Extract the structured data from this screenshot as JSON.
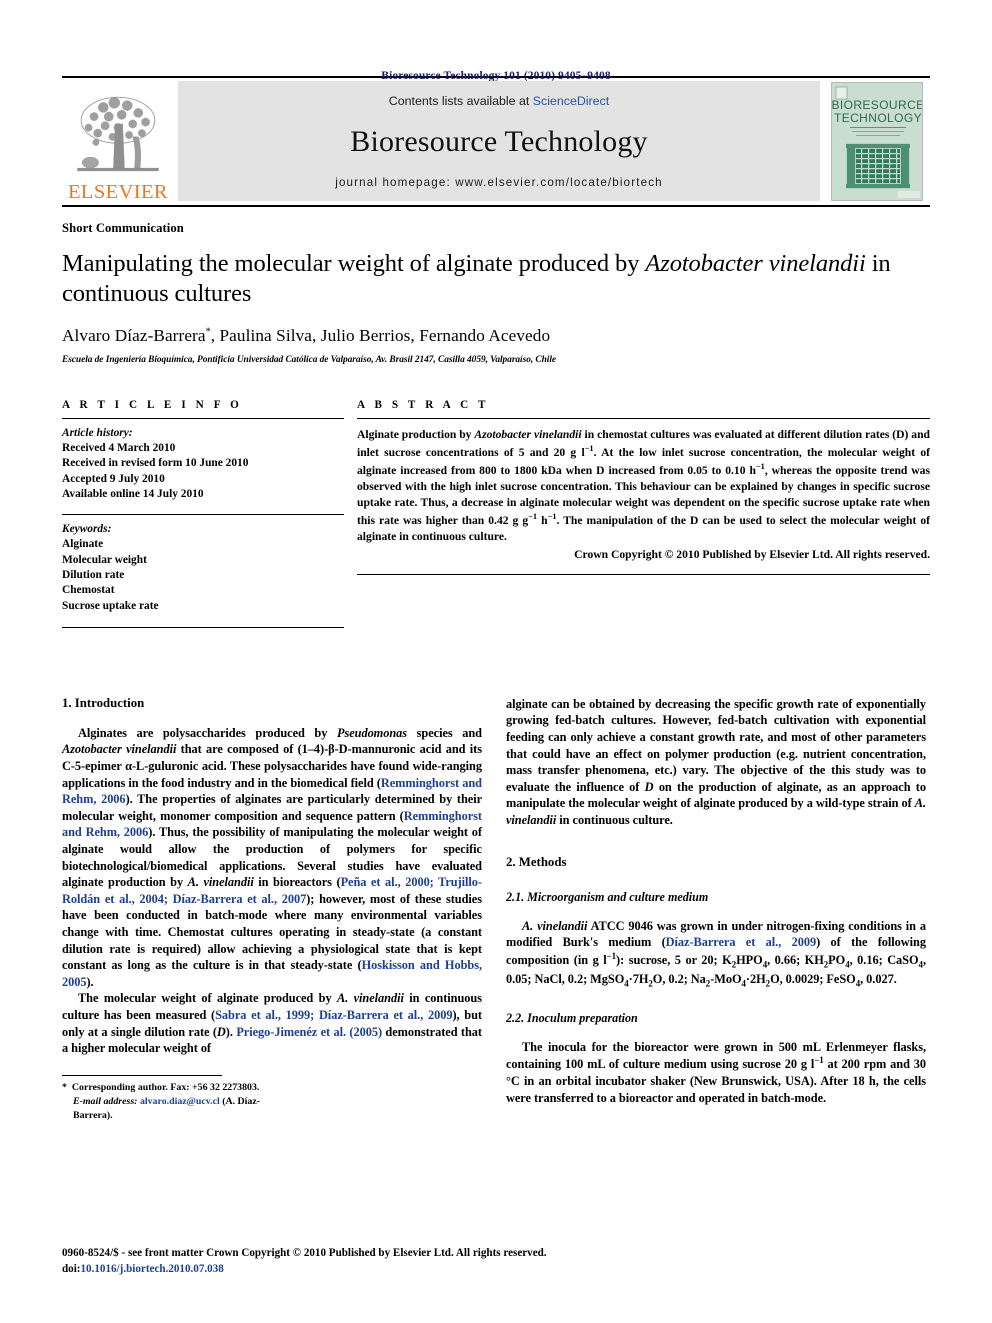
{
  "running_head": "Bioresource Technology 101 (2010) 9405–9408",
  "masthead": {
    "contents_prefix": "Contents lists available at ",
    "sciencedirect": "ScienceDirect",
    "journal_title": "Bioresource Technology",
    "homepage": "journal homepage: www.elsevier.com/locate/biortech",
    "publisher_wordmark": "ELSEVIER",
    "publisher_color": "#E87722",
    "link_color": "#2a4fb5",
    "cover_title_line1": "BIORESOURCE",
    "cover_title_line2": "TECHNOLOGY",
    "cover_accent": "#3f7f63"
  },
  "article": {
    "section_type": "Short Communication",
    "title_part1": "Manipulating the molecular weight of alginate produced by ",
    "title_italic": "Azotobacter vinelandii",
    "title_part2": " in continuous cultures",
    "authors": "Alvaro Díaz-Barrera",
    "authors_rest": ", Paulina Silva, Julio Berrios, Fernando Acevedo",
    "corresponding_marker": "*",
    "affiliation": "Escuela de Ingeniería Bioquímica, Pontificia Universidad Católica de Valparaíso, Av. Brasil 2147, Casilla 4059, Valparaíso, Chile"
  },
  "article_info": {
    "heading": "A R T I C L E   I N F O",
    "history_label": "Article history:",
    "history": [
      "Received 4 March 2010",
      "Received in revised form 10 June 2010",
      "Accepted 9 July 2010",
      "Available online 14 July 2010"
    ],
    "keywords_label": "Keywords:",
    "keywords": [
      "Alginate",
      "Molecular weight",
      "Dilution rate",
      "Chemostat",
      "Sucrose uptake rate"
    ]
  },
  "abstract": {
    "heading": "A B S T R A C T",
    "text_1": "Alginate production by ",
    "text_italic_1": "Azotobacter vinelandii",
    "text_2": " in chemostat cultures was evaluated at different dilution rates (D) and inlet sucrose concentrations of 5 and 20 g l",
    "sup_1": "−1",
    "text_3": ". At the low inlet sucrose concentration, the molecular weight of alginate increased from 800 to 1800 kDa when D increased from 0.05 to 0.10 h",
    "sup_2": "−1",
    "text_4": ", whereas the opposite trend was observed with the high inlet sucrose concentration. This behaviour can be explained by changes in specific sucrose uptake rate. Thus, a decrease in alginate molecular weight was dependent on the specific sucrose uptake rate when this rate was higher than 0.42 g g",
    "sup_3": "−1",
    "text_5": " h",
    "sup_4": "−1",
    "text_6": ". The manipulation of the D can be used to select the molecular weight of alginate in continuous culture.",
    "copyright": "Crown Copyright © 2010 Published by Elsevier Ltd. All rights reserved."
  },
  "sections": {
    "introduction_heading": "1. Introduction",
    "intro_p1_a": "Alginates are polysaccharides produced by ",
    "intro_p1_it1": "Pseudomonas",
    "intro_p1_b": " species and ",
    "intro_p1_it2": "Azotobacter vinelandii",
    "intro_p1_c": " that are composed of (1–4)-β-",
    "intro_p1_sc1": "D",
    "intro_p1_d": "-mannuronic acid and its C-5-epimer α-",
    "intro_p1_sc2": "L",
    "intro_p1_e": "-guluronic acid. These polysaccharides have found wide-ranging applications in the food industry and in the biomedical field (",
    "intro_p1_cite1": "Remminghorst and Rehm, 2006",
    "intro_p1_f": "). The properties of alginates are particularly determined by their molecular weight, monomer composition and sequence pattern (",
    "intro_p1_cite2": "Remminghorst and Rehm, 2006",
    "intro_p1_g": "). Thus, the possibility of manipulating the molecular weight of alginate would allow the production of polymers for specific biotechnological/biomedical applications. Several studies have evaluated alginate production by ",
    "intro_p1_it3": "A. vinelandii",
    "intro_p1_h": " in bioreactors (",
    "intro_p1_cite3": "Peña et al., 2000; Trujillo-Roldán et al., 2004; Díaz-Barrera et al., 2007",
    "intro_p1_i": "); however, most of these studies have been conducted in batch-mode where many environmental variables change with time. Chemostat cultures operating in steady-state (a constant dilution rate is required) allow achieving a physiological state that is kept constant as long as the culture is in that steady-state (",
    "intro_p1_cite4": "Hoskisson and Hobbs, 2005",
    "intro_p1_j": ").",
    "intro_p2_a": "The molecular weight of alginate produced by ",
    "intro_p2_it1": "A. vinelandii",
    "intro_p2_b": " in continuous culture has been measured (",
    "intro_p2_cite1": "Sabra et al., 1999; Díaz-Barrera et al., 2009",
    "intro_p2_c": "), but only at a single dilution rate (",
    "intro_p2_it2": "D",
    "intro_p2_d": "). ",
    "intro_p2_cite2": "Priego-Jimenéz et al. (2005)",
    "intro_p2_e": " demonstrated that a higher molecular weight of",
    "intro_cont_a": "alginate can be obtained by decreasing the specific growth rate of exponentially growing fed-batch cultures. However, fed-batch cultivation with exponential feeding can only achieve a constant growth rate, and most of other parameters that could have an effect on polymer production (e.g. nutrient concentration, mass transfer phenomena, etc.) vary. The objective of the this study was to evaluate the influence of ",
    "intro_cont_it1": "D",
    "intro_cont_b": " on the production of alginate, as an approach to manipulate the molecular weight of alginate produced by a wild-type strain of ",
    "intro_cont_it2": "A. vinelandii",
    "intro_cont_c": " in continuous culture.",
    "methods_heading": "2. Methods",
    "sub_21_heading": "2.1. Microorganism and culture medium",
    "sub_21_a": "A. vinelandii",
    "sub_21_b": " ATCC 9046 was grown in under nitrogen-fixing conditions in a modified Burk's medium (",
    "sub_21_cite": "Díaz-Barrera et al., 2009",
    "sub_21_c": ") of the following composition (in g l",
    "sub_21_sup": "−1",
    "sub_21_d": "): sucrose, 5 or 20; K",
    "sub_21_sub1": "2",
    "sub_21_e": "HPO",
    "sub_21_sub2": "4",
    "sub_21_f": ", 0.66; KH",
    "sub_21_sub3": "2",
    "sub_21_g": "PO",
    "sub_21_sub4": "4",
    "sub_21_h": ", 0.16; CaSO",
    "sub_21_sub5": "4",
    "sub_21_i": ", 0.05; NaCl, 0.2; MgSO",
    "sub_21_sub6": "4",
    "sub_21_j": "·7H",
    "sub_21_sub7": "2",
    "sub_21_k": "O, 0.2; Na",
    "sub_21_sub8": "2",
    "sub_21_l": "-MoO",
    "sub_21_sub9": "4",
    "sub_21_m": "·2H",
    "sub_21_sub10": "2",
    "sub_21_n": "O, 0.0029; FeSO",
    "sub_21_sub11": "4",
    "sub_21_o": ", 0.027.",
    "sub_22_heading": "2.2. Inoculum preparation",
    "sub_22_a": "The inocula for the bioreactor were grown in 500 mL Erlenmeyer flasks, containing 100 mL of culture medium using sucrose 20 g l",
    "sub_22_sup": "−1",
    "sub_22_b": " at 200 rpm and 30 °C in an orbital incubator shaker (New Brunswick, USA). After 18 h, the cells were transferred to a bioreactor and operated in batch-mode."
  },
  "footnote": {
    "corresponding": "Corresponding author. Fax: +56 32 2273803.",
    "email_label": "E-mail address:",
    "email": "alvaro.diaz@ucv.cl",
    "email_suffix": " (A. Díaz-Barrera)."
  },
  "page_footer": {
    "issn_line": "0960-8524/$ - see front matter Crown Copyright © 2010 Published by Elsevier Ltd. All rights reserved.",
    "doi_prefix": "doi:",
    "doi": "10.1016/j.biortech.2010.07.038"
  }
}
